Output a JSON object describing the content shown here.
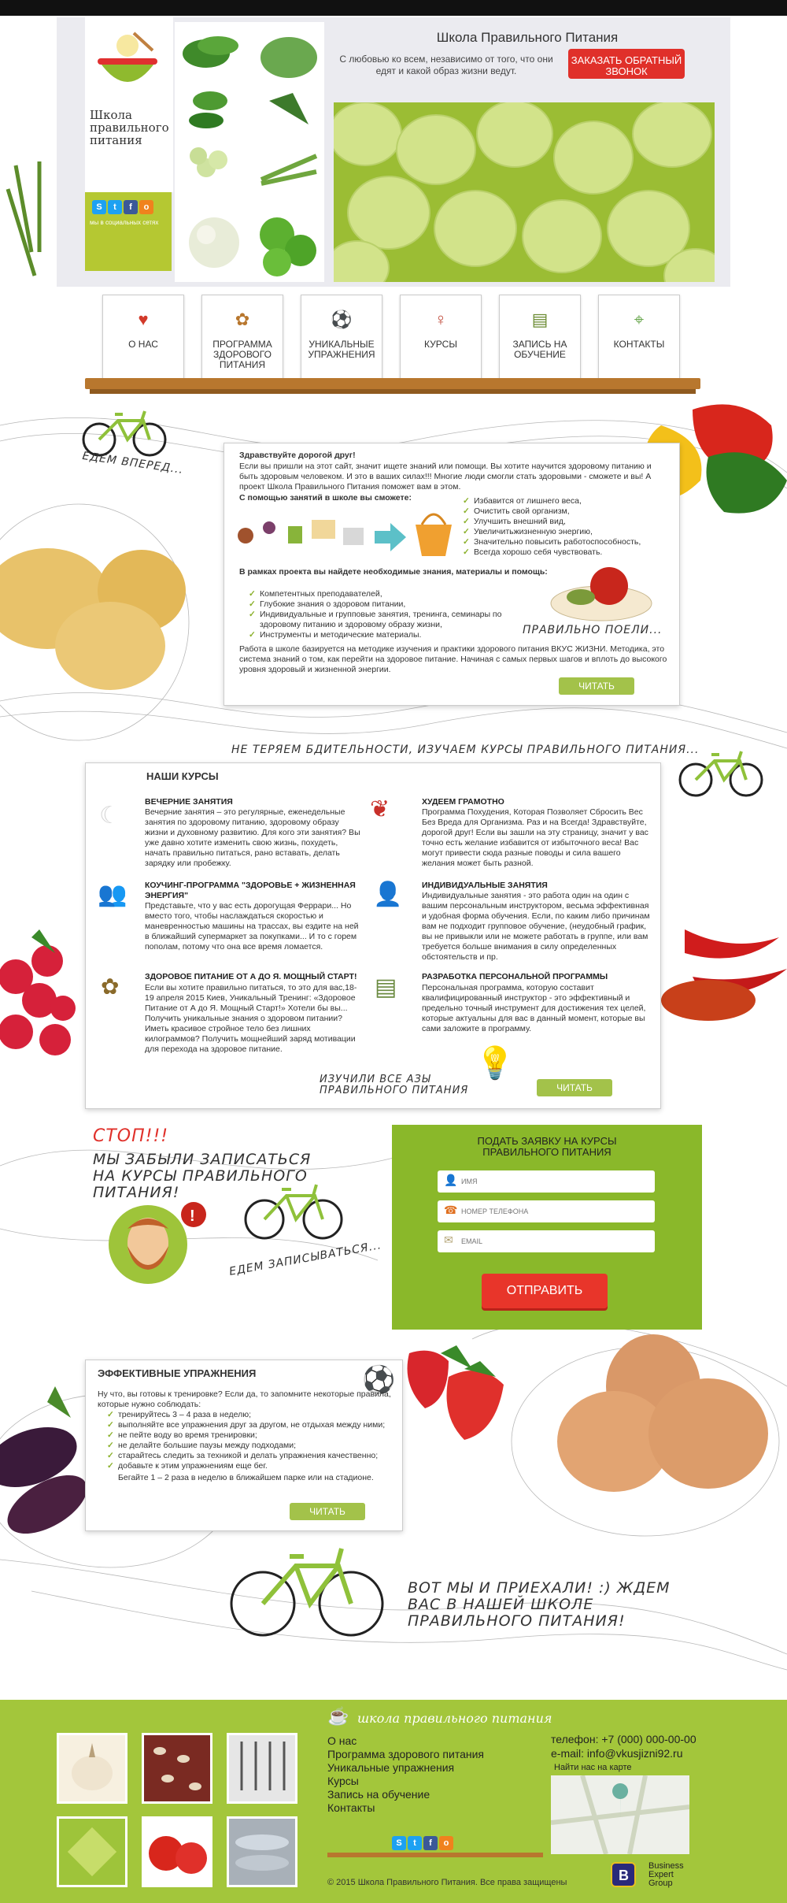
{
  "header": {
    "school_name": "Школа правильного питания",
    "social_caption": "мы в социальных сетях",
    "title": "Школа Правильного Питания",
    "subtitle": "С любовью ко всем, независимо от того, что они едят и какой образ жизни ведут.",
    "callback_button": "ЗАКАЗАТЬ ОБРАТНЫЙ ЗВОНОК"
  },
  "nav": {
    "items": [
      {
        "label": "О НАС",
        "icon": "heart-icon"
      },
      {
        "label": "ПРОГРАММА ЗДОРОВОГО ПИТАНИЯ",
        "icon": "sprout-icon"
      },
      {
        "label": "УНИКАЛЬНЫЕ УПРАЖНЕНИЯ",
        "icon": "ball-icon"
      },
      {
        "label": "КУРСЫ",
        "icon": "microphone-icon"
      },
      {
        "label": "ЗАПИСЬ НА ОБУЧЕНИЕ",
        "icon": "clipboard-icon"
      },
      {
        "label": "КОНТАКТЫ",
        "icon": "map-icon"
      }
    ]
  },
  "intro": {
    "tagline": "ЕДЕМ ВПЕРЕД...",
    "greeting": "Здравствуйте дорогой друг!",
    "para1": "Если вы пришли на этот сайт, значит ищете знаний или помощи.  Вы хотите научится здоровому питанию и быть здоровым человеком. И это в ваших силах!!!  Многие люди смогли стать здоровыми - сможете и вы! А проект Школа Правильного Питания поможет вам в этом.",
    "subheading": "С помощью занятий в школе вы сможете:",
    "benefits": [
      "Избавится от лишнего веса,",
      "Очистить свой организм,",
      "Улучшить внешний вид,",
      "Увеличитьжизненную энергию,",
      "Значительно повысить работоспособность,",
      "Всегда  хорошо себя чувствовать."
    ],
    "project_heading": "В рамках проекта вы найдете необходимые знания, материалы и помощь:",
    "resources": [
      "Компетентных преподавателей,",
      "Глубокие знания о здоровом питании,",
      "Индивидуальные и групповые занятия, тренинга, семинары по здоровому питанию и здоровому образу жизни,",
      "Инструменты и методические материалы."
    ],
    "eat_right": "ПРАВИЛЬНО ПОЕЛИ...",
    "closing": "Работа в школе базируется на методике изучения и практики здорового питания ВКУС ЖИЗНИ. Методика, это система знаний о том, как перейти на здоровое питание. Начиная с самых первых шагов и вплоть до высокого уровня здоровый и жизненной энергии.",
    "read_button": "ЧИТАТЬ"
  },
  "courses": {
    "banner": "НЕ ТЕРЯЕМ БДИТЕЛЬНОСТИ, ИЗУЧАЕМ КУРСЫ ПРАВИЛЬНОГО ПИТАНИЯ...",
    "title": "НАШИ КУРСЫ",
    "left": [
      {
        "icon": "moon-icon",
        "heading": "ВЕЧЕРНИЕ ЗАНЯТИЯ",
        "text": "Вечерние занятия – это регулярные, еженедельные занятия по здоровому питанию, здоровому образу жизни и духовному развитию. Для кого эти занятия? Вы уже давно хотите изменить свою жизнь, похудеть, начать правильно питаться, рано вставать, делать зарядку или пробежку."
      },
      {
        "icon": "people-icon",
        "heading": "КОУЧИНГ-ПРОГРАММА \"ЗДОРОВЬЕ + ЖИЗНЕННАЯ ЭНЕРГИЯ\"",
        "text": "Представьте, что у вас есть дорогущая Феррари... Но вместо того, чтобы наслаждаться скоростью и маневренностью машины на трассах, вы ездите на ней в ближайший супермаркет за покупками... И то с горем пополам, потому что она все время ломается."
      },
      {
        "icon": "sprout-icon",
        "heading": "ЗДОРОВОЕ ПИТАНИЕ ОТ А ДО Я. МОЩНЫЙ СТАРТ!",
        "text": "Если вы хотите  правильно питаться, то это для вас,18-19 апреля 2015  Киев, Уникальный Тренинг: «Здоровое Питание от А до Я. Мощный Старт!» Хотели бы вы... Получить уникальные знания о здоровом питании?  Иметь красивое стройное тело без лишних килограммов?  Получить мощнейший заряд мотивации для перехода на здоровое питание."
      }
    ],
    "right": [
      {
        "icon": "butterfly-icon",
        "heading": "ХУДЕЕМ ГРАМОТНО",
        "text": "Программа Похудения, Которая Позволяет Сбросить Вес Без Вреда для Организма. Раз и на Всегда! Здравствуйте, дорогой друг! Если вы зашли на эту страницу, значит у вас точно есть желание избавится от избыточного веса! Вас  могут привести сюда разные поводы и сила вашего желания может быть разной."
      },
      {
        "icon": "person-icon",
        "heading": "ИНДИВИДУАЛЬНЫЕ ЗАНЯТИЯ",
        "text": "Индивидуальные занятия - это работа один на один с вашим персональным инструктором, весьма эффективная и удобная форма обучения.     Если, по каким либо причинам вам не подходит групповое обучение, (неудобный график, вы не привыкли или не можете работать в группе, или вам требуется больше внимания в силу определенных обстоятельств и пр."
      },
      {
        "icon": "checklist-icon",
        "heading": "РАЗРАБОТКА ПЕРСОНАЛЬНОЙ ПРОГРАММЫ",
        "text": "Персональная программа, которую составит квалифицированный инструктор - это эффективный и предельно точный инструмент для достижения тех целей, которые актуальны для вас в данный момент, которые вы сами заложите в программу."
      }
    ],
    "learned": "ИЗУЧИЛИ ВСЕ АЗЫ ПРАВИЛЬНОГО ПИТАНИЯ",
    "read_button": "ЧИТАТЬ"
  },
  "signup": {
    "stop": "СТОП!!!",
    "forgot": "МЫ ЗАБЫЛИ ЗАПИСАТЬСЯ НА КУРСЫ ПРАВИЛЬНОГО ПИТАНИЯ!",
    "going": "ЕДЕМ ЗАПИСЫВАТЬСЯ...",
    "form_title": "ПОДАТЬ ЗАЯВКУ НА КУРСЫ ПРАВИЛЬНОГО ПИТАНИЯ",
    "name_placeholder": "ИМЯ",
    "phone_placeholder": "НОМЕР ТЕЛЕФОНА",
    "email_placeholder": "EMAIL",
    "submit": "ОТПРАВИТЬ"
  },
  "exercises": {
    "title": "ЭФФЕКТИВНЫЕ УПРАЖНЕНИЯ",
    "intro": "Ну что, вы готовы к тренировке? Если да, то запомните некоторые правила, которые нужно соблюдать:",
    "rules": [
      "тренируйтесь 3 – 4 раза в неделю;",
      "выполняйте все упражнения друг за другом, не отдыхая между ними;",
      "не пейте воду во время тренировки;",
      "не делайте большие паузы между подходами;",
      "старайтесь следить за техникой и делать упражнения качественно;",
      "добавьте к этим упражнениям еще бег."
    ],
    "extra": "Бегайте 1 – 2 раза в неделю в ближайшем парке или на стадионе.",
    "read_button": "ЧИТАТЬ",
    "arrived": "ВОТ МЫ И ПРИЕХАЛИ! :) ЖДЕМ ВАС В НАШЕЙ ШКОЛЕ ПРАВИЛЬНОГО ПИТАНИЯ!"
  },
  "footer": {
    "brand": "школа правильного питания",
    "menu": [
      "О нас",
      "Программа здорового питания",
      "Уникальные упражнения",
      "Курсы",
      "Запись на обучение",
      "Контакты"
    ],
    "phone_label": "телефон:",
    "phone": "+7 (000) 000-00-00",
    "email_label": "e-mail:",
    "email": "info@vkusjizni92.ru",
    "map_caption": "Найти нас на карте",
    "copyright": "© 2015 Школа Правильного Питания. Все права защищены",
    "partner_line1": "Business",
    "partner_line2": "Expert",
    "partner_line3": "Group"
  },
  "colors": {
    "accent_green": "#a3c63b",
    "accent_red": "#e0302a",
    "shelf": "#b8772e"
  }
}
